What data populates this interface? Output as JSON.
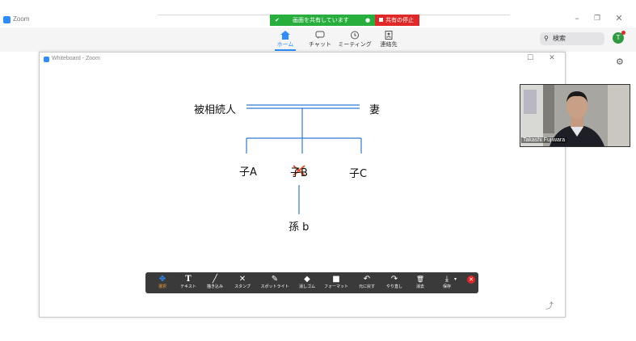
{
  "window": {
    "title": "Zoom"
  },
  "share": {
    "status": "画面を共有しています",
    "stop": "共有の停止"
  },
  "nav": [
    {
      "label": "ホーム",
      "icon": "home-icon"
    },
    {
      "label": "チャット",
      "icon": "chat-icon"
    },
    {
      "label": "ミーティング",
      "icon": "clock-icon"
    },
    {
      "label": "連絡先",
      "icon": "contacts-icon"
    }
  ],
  "search": {
    "label": "検索"
  },
  "avatar": {
    "initial": "T"
  },
  "whiteboard": {
    "title": "Whiteboard - Zoom",
    "nodes": {
      "deceased": "被相続人",
      "spouse": "妻",
      "child_a": "子A",
      "child_b": "子B",
      "child_c": "子C",
      "grandchild": "孫 b"
    }
  },
  "toolbar": [
    {
      "label": "選択",
      "icon": "move-icon",
      "glyph": "✥"
    },
    {
      "label": "テキスト",
      "icon": "text-icon",
      "glyph": "T"
    },
    {
      "label": "描き込み",
      "icon": "pen-icon",
      "glyph": "╱"
    },
    {
      "label": "スタンプ",
      "icon": "stamp-x-icon",
      "glyph": "✕"
    },
    {
      "label": "スポットライト",
      "icon": "spotlight-icon",
      "glyph": "✎"
    },
    {
      "label": "消しゴム",
      "icon": "eraser-icon",
      "glyph": "◆"
    },
    {
      "label": "フォーマット",
      "icon": "format-icon",
      "glyph": "■"
    },
    {
      "label": "元に戻す",
      "icon": "undo-icon",
      "glyph": "↶"
    },
    {
      "label": "やり直し",
      "icon": "redo-icon",
      "glyph": "↷"
    },
    {
      "label": "消去",
      "icon": "trash-icon",
      "glyph": "🗑"
    },
    {
      "label": "保存",
      "icon": "save-icon",
      "glyph": "⤓"
    }
  ],
  "video": {
    "name": "Takashi Fujiwara"
  },
  "colors": {
    "accent": "#2d8cff",
    "share_green": "#27ae3c",
    "share_red": "#e02828",
    "tree_line": "#2d7bd8",
    "cross": "#e8542a"
  }
}
